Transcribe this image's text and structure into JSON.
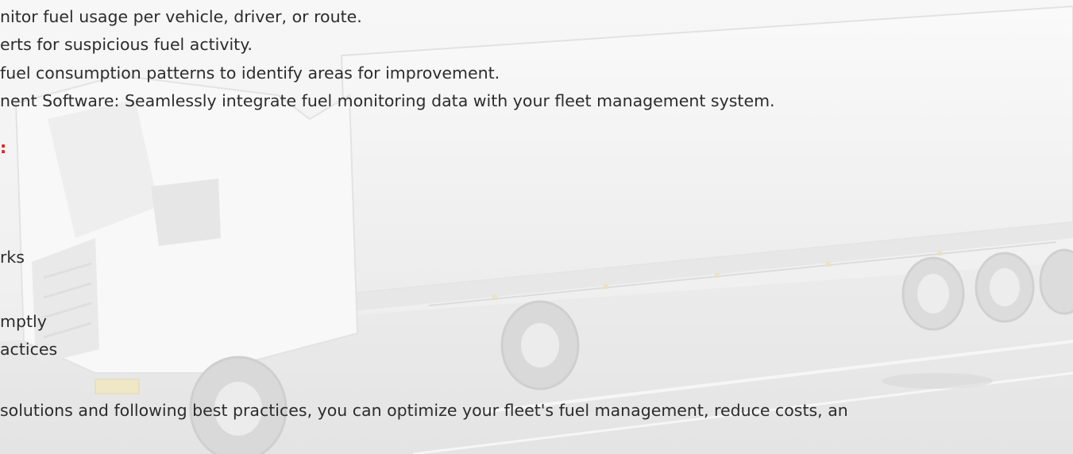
{
  "lines": {
    "l1": "nitor fuel usage per vehicle, driver, or route.",
    "l2": "erts for suspicious fuel activity.",
    "l3": " fuel consumption patterns to identify areas for improvement.",
    "l4": "nent Software: Seamlessly integrate fuel monitoring data with your fleet management system.",
    "l5": ":",
    "l6": "rks",
    "l7": "mptly",
    "l8": "actices",
    "l9": "solutions and following best practices, you can optimize your fleet's fuel management, reduce costs, an"
  },
  "colors": {
    "heading": "#e01b1b",
    "text": "#2c2c2c",
    "background": "#f4f4f4"
  }
}
